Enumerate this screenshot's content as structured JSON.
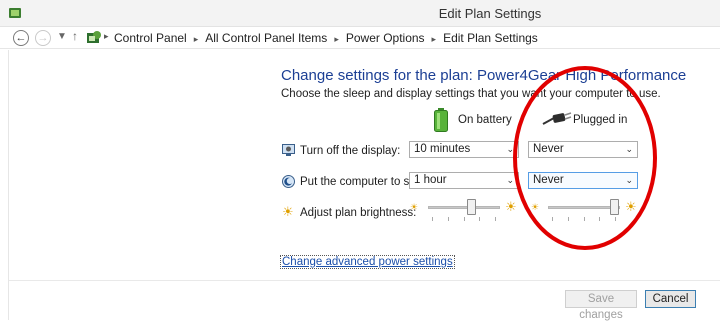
{
  "window": {
    "title": "Edit Plan Settings"
  },
  "nav": {
    "back_icon": "back-arrow-icon",
    "forward_icon": "forward-arrow-icon",
    "recent_icon": "chevron-down-icon",
    "up_icon": "up-arrow-icon",
    "location_icon": "control-panel-icon"
  },
  "breadcrumb": [
    "Control Panel",
    "All Control Panel Items",
    "Power Options",
    "Edit Plan Settings"
  ],
  "main": {
    "heading": "Change settings for the plan: Power4Gear High Performance",
    "subheading": "Choose the sleep and display settings that you want your computer to use.",
    "columns": {
      "battery": "On battery",
      "plugged": "Plugged in"
    },
    "rows": [
      {
        "label": "Turn off the display:",
        "battery_value": "10 minutes",
        "plugged_value": "Never"
      },
      {
        "label": "Put the computer to sleep:",
        "battery_value": "1 hour",
        "plugged_value": "Never"
      },
      {
        "label": "Adjust plan brightness:",
        "battery_brightness": 0.62,
        "plugged_brightness": 0.98
      }
    ],
    "advanced_link": "Change advanced power settings"
  },
  "footer": {
    "save_label": "Save changes",
    "cancel_label": "Cancel"
  },
  "colors": {
    "heading": "#1c3f94",
    "annotation": "#e10000",
    "link": "#1c4faa"
  }
}
